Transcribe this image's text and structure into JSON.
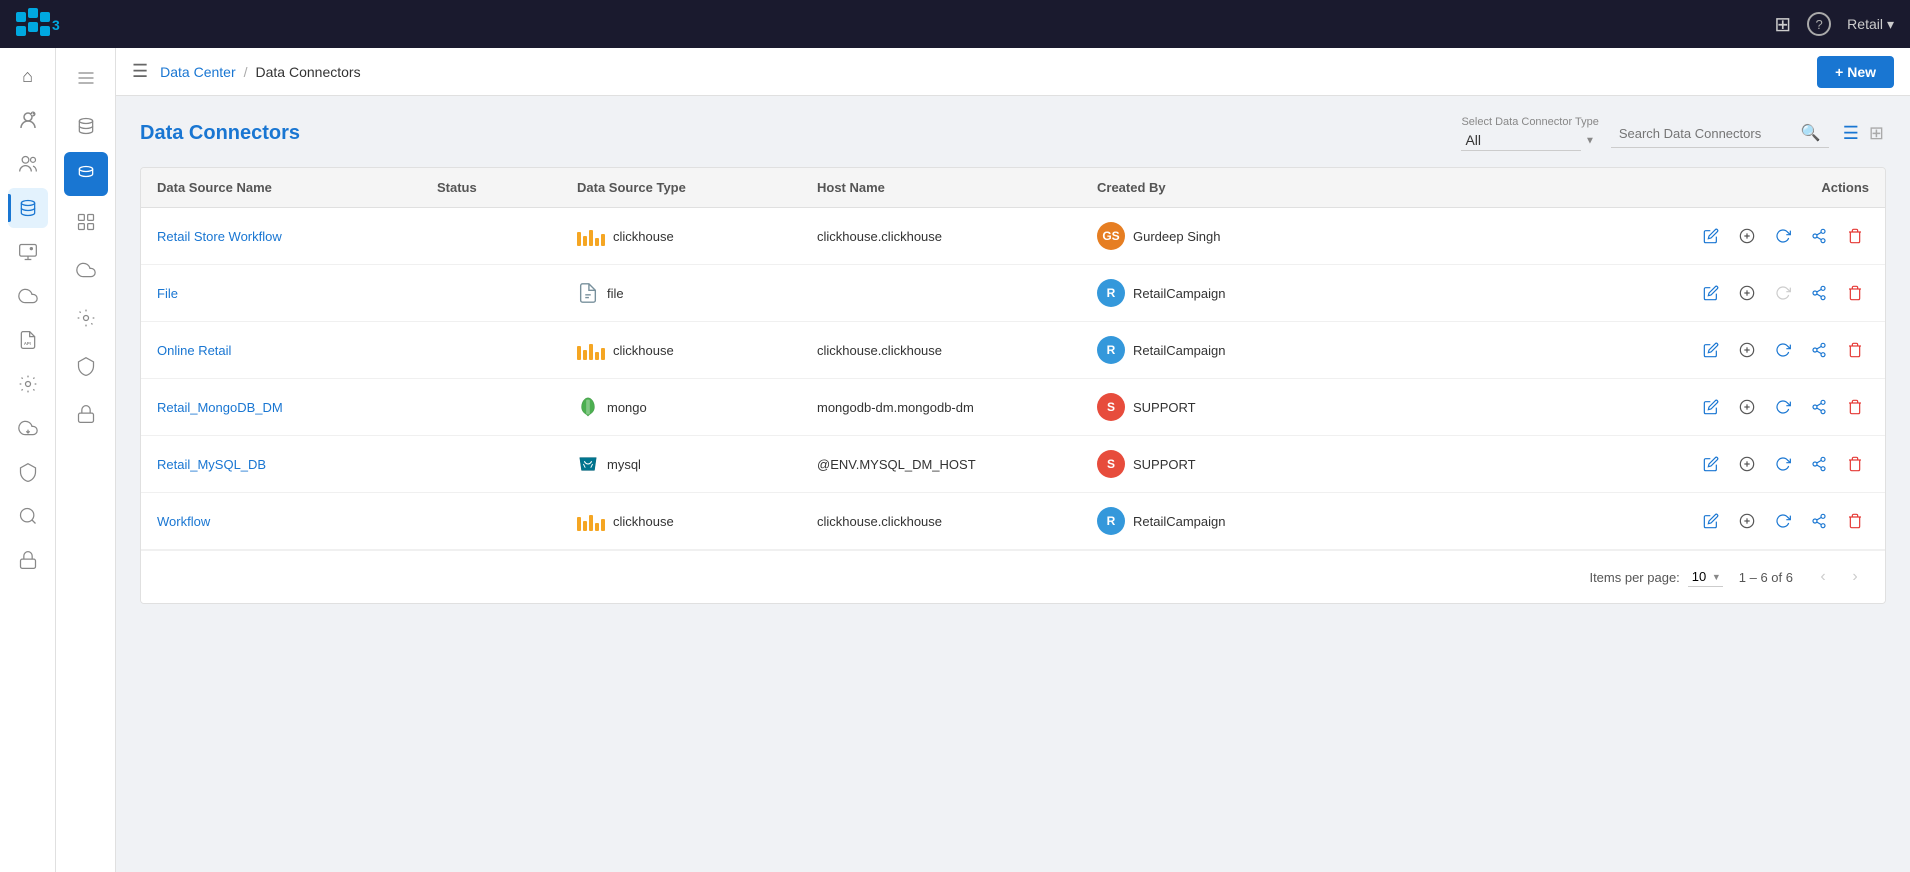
{
  "topbar": {
    "account_label": "Retail",
    "grid_icon": "⊞",
    "help_icon": "?",
    "chevron_icon": "▾"
  },
  "header": {
    "breadcrumb_parent": "Data Center",
    "breadcrumb_separator": "/",
    "breadcrumb_current": "Data Connectors",
    "new_button_label": "+ New"
  },
  "page": {
    "title": "Data Connectors",
    "type_filter_label": "Select Data Connector Type",
    "type_filter_value": "All",
    "search_placeholder": "Search Data Connectors"
  },
  "table": {
    "columns": [
      "Data Source Name",
      "Status",
      "Data Source Type",
      "Host Name",
      "Created By",
      "Actions"
    ],
    "rows": [
      {
        "name": "Retail Store Workflow",
        "status": "",
        "type": "clickhouse",
        "host": "clickhouse.clickhouse",
        "created_by_initials": "GS",
        "created_by_name": "Gurdeep Singh",
        "avatar_class": "avatar-gs"
      },
      {
        "name": "File",
        "status": "",
        "type": "file",
        "host": "",
        "created_by_initials": "R",
        "created_by_name": "RetailCampaign",
        "avatar_class": "avatar-r"
      },
      {
        "name": "Online Retail",
        "status": "",
        "type": "clickhouse",
        "host": "clickhouse.clickhouse",
        "created_by_initials": "R",
        "created_by_name": "RetailCampaign",
        "avatar_class": "avatar-r"
      },
      {
        "name": "Retail_MongoDB_DM",
        "status": "",
        "type": "mongo",
        "host": "mongodb-dm.mongodb-dm",
        "created_by_initials": "S",
        "created_by_name": "SUPPORT",
        "avatar_class": "avatar-s"
      },
      {
        "name": "Retail_MySQL_DB",
        "status": "",
        "type": "mysql",
        "host": "@ENV.MYSQL_DM_HOST",
        "created_by_initials": "S",
        "created_by_name": "SUPPORT",
        "avatar_class": "avatar-s"
      },
      {
        "name": "Workflow",
        "status": "",
        "type": "clickhouse",
        "host": "clickhouse.clickhouse",
        "created_by_initials": "R",
        "created_by_name": "RetailCampaign",
        "avatar_class": "avatar-r"
      }
    ]
  },
  "pagination": {
    "items_per_page_label": "Items per page:",
    "items_per_page_value": "10",
    "range_label": "1 – 6 of 6"
  },
  "left_sidebar": {
    "icons": [
      {
        "name": "home-icon",
        "glyph": "⌂",
        "active": false
      },
      {
        "name": "user-manage-icon",
        "glyph": "👤",
        "active": false
      },
      {
        "name": "users-icon",
        "glyph": "👥",
        "active": false
      },
      {
        "name": "database-icon",
        "glyph": "🗄",
        "active": true
      },
      {
        "name": "monitor-icon",
        "glyph": "🖥",
        "active": false
      },
      {
        "name": "cloud-icon",
        "glyph": "☁",
        "active": false
      },
      {
        "name": "code-icon",
        "glyph": "⚙",
        "active": false
      },
      {
        "name": "settings-data-icon",
        "glyph": "⚙",
        "active": false
      },
      {
        "name": "cloud2-icon",
        "glyph": "☁",
        "active": false
      },
      {
        "name": "admin-icon",
        "glyph": "⚙",
        "active": false
      },
      {
        "name": "security-icon",
        "glyph": "🔒",
        "active": false
      },
      {
        "name": "audit-icon",
        "glyph": "🔍",
        "active": false
      }
    ]
  },
  "second_sidebar": {
    "icons": [
      {
        "name": "dc-nav-1",
        "glyph": "≡",
        "active": false
      },
      {
        "name": "dc-nav-2",
        "glyph": "🗄",
        "active": false
      },
      {
        "name": "dc-nav-db",
        "glyph": "⬡",
        "active": true
      },
      {
        "name": "dc-nav-4",
        "glyph": "⬢",
        "active": false
      },
      {
        "name": "dc-nav-5",
        "glyph": "☁",
        "active": false
      },
      {
        "name": "dc-nav-6",
        "glyph": "⚙",
        "active": false
      },
      {
        "name": "dc-nav-7",
        "glyph": "⚙",
        "active": false
      },
      {
        "name": "dc-nav-8",
        "glyph": "🔒",
        "active": false
      }
    ]
  }
}
